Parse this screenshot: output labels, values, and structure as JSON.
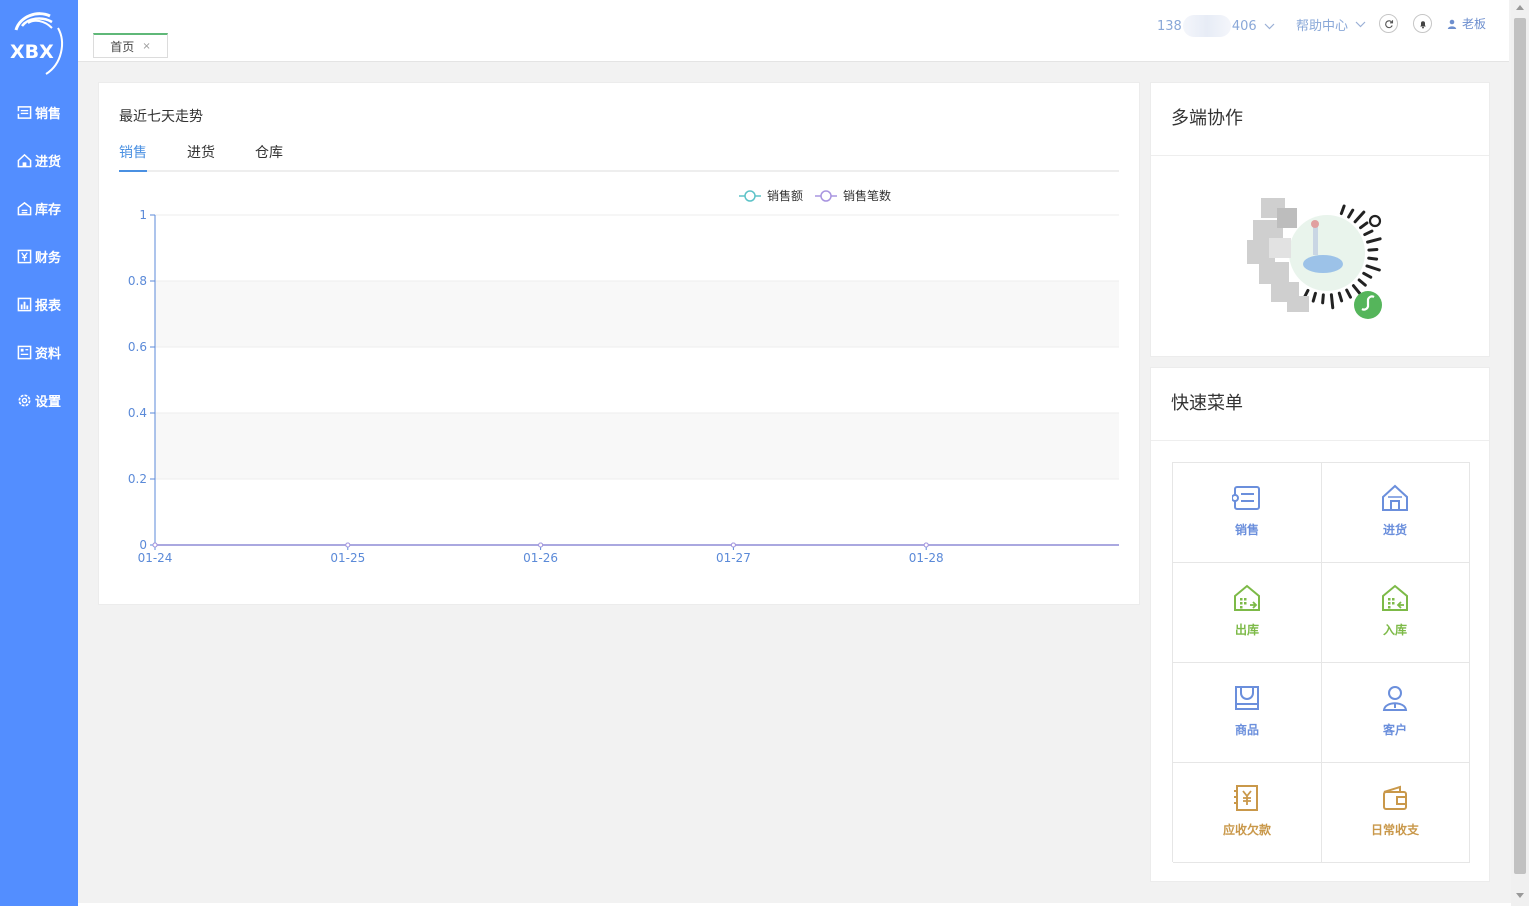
{
  "sidebar": {
    "logo_text": "XBX",
    "items": [
      {
        "label": "销售",
        "icon": "sales-icon"
      },
      {
        "label": "进货",
        "icon": "home-icon"
      },
      {
        "label": "库存",
        "icon": "warehouse-icon"
      },
      {
        "label": "财务",
        "icon": "yen-icon"
      },
      {
        "label": "报表",
        "icon": "report-icon"
      },
      {
        "label": "资料",
        "icon": "document-icon"
      },
      {
        "label": "设置",
        "icon": "gear-icon"
      }
    ]
  },
  "header": {
    "tab_label": "首页",
    "tab_close": "×",
    "phone_prefix": "138",
    "phone_suffix": "406",
    "help_label": "帮助中心",
    "user_name": "老板"
  },
  "trend": {
    "title": "最近七天走势",
    "tabs": [
      "销售",
      "进货",
      "仓库"
    ],
    "active_tab": 0
  },
  "chart_data": {
    "type": "line",
    "x": [
      "01-24",
      "01-25",
      "01-26",
      "01-27",
      "01-28"
    ],
    "series": [
      {
        "name": "销售额",
        "values": [
          0,
          0,
          0,
          0,
          0
        ],
        "color": "#5ec3c8"
      },
      {
        "name": "销售笔数",
        "values": [
          0,
          0,
          0,
          0,
          0
        ],
        "color": "#a995e0"
      }
    ],
    "yticks": [
      "0",
      "0.2",
      "0.4",
      "0.6",
      "0.8",
      "1"
    ],
    "ylim": [
      0,
      1
    ],
    "grid": true,
    "legend": "top-center"
  },
  "coop": {
    "title": "多端协作"
  },
  "quick_menu": {
    "title": "快速菜单",
    "items": [
      {
        "label": "销售",
        "icon": "sales-icon",
        "color": "#6b8fdc"
      },
      {
        "label": "进货",
        "icon": "home-icon",
        "color": "#6b8fdc"
      },
      {
        "label": "出库",
        "icon": "stock-out-icon",
        "color": "#7dba48"
      },
      {
        "label": "入库",
        "icon": "stock-in-icon",
        "color": "#7dba48"
      },
      {
        "label": "商品",
        "icon": "goods-icon",
        "color": "#6b8fdc"
      },
      {
        "label": "客户",
        "icon": "customer-icon",
        "color": "#6b8fdc"
      },
      {
        "label": "应收欠款",
        "icon": "receivable-icon",
        "color": "#c9984a"
      },
      {
        "label": "日常收支",
        "icon": "wallet-icon",
        "color": "#c9984a"
      }
    ]
  }
}
